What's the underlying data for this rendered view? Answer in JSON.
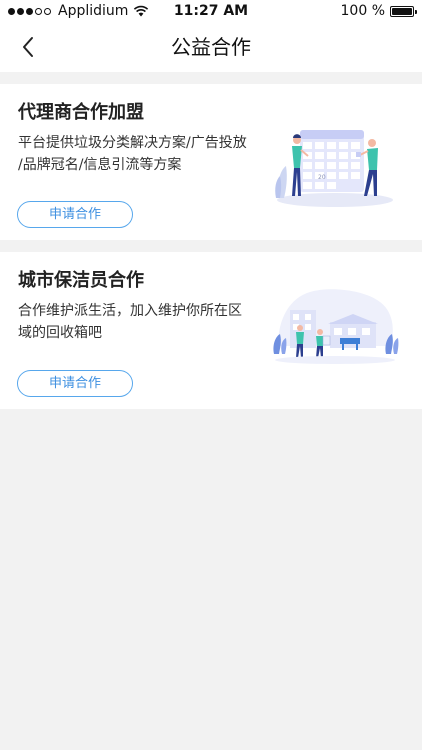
{
  "status_bar": {
    "carrier": "Applidium",
    "time": "11:27 AM",
    "battery": "100 %",
    "signal_bars": 3,
    "signal_total": 5
  },
  "nav": {
    "title": "公益合作",
    "back_icon": "chevron-left-icon"
  },
  "cards": [
    {
      "title": "代理商合作加盟",
      "desc_line1": "平台提供垃圾分类解决方案/广告投放",
      "desc_line2": "/品牌冠名/信息引流等方案",
      "button": "申请合作",
      "illustration": "calendar-team-illustration",
      "illustration_text": "20"
    },
    {
      "title": "城市保洁员合作",
      "desc_line1": "合作维护派生活，加入维护你所在区",
      "desc_line2": "域的回收箱吧",
      "button": "申请合作",
      "illustration": "city-cleaners-illustration"
    }
  ],
  "colors": {
    "accent": "#3d8fe0",
    "background": "#f2f2f2"
  }
}
